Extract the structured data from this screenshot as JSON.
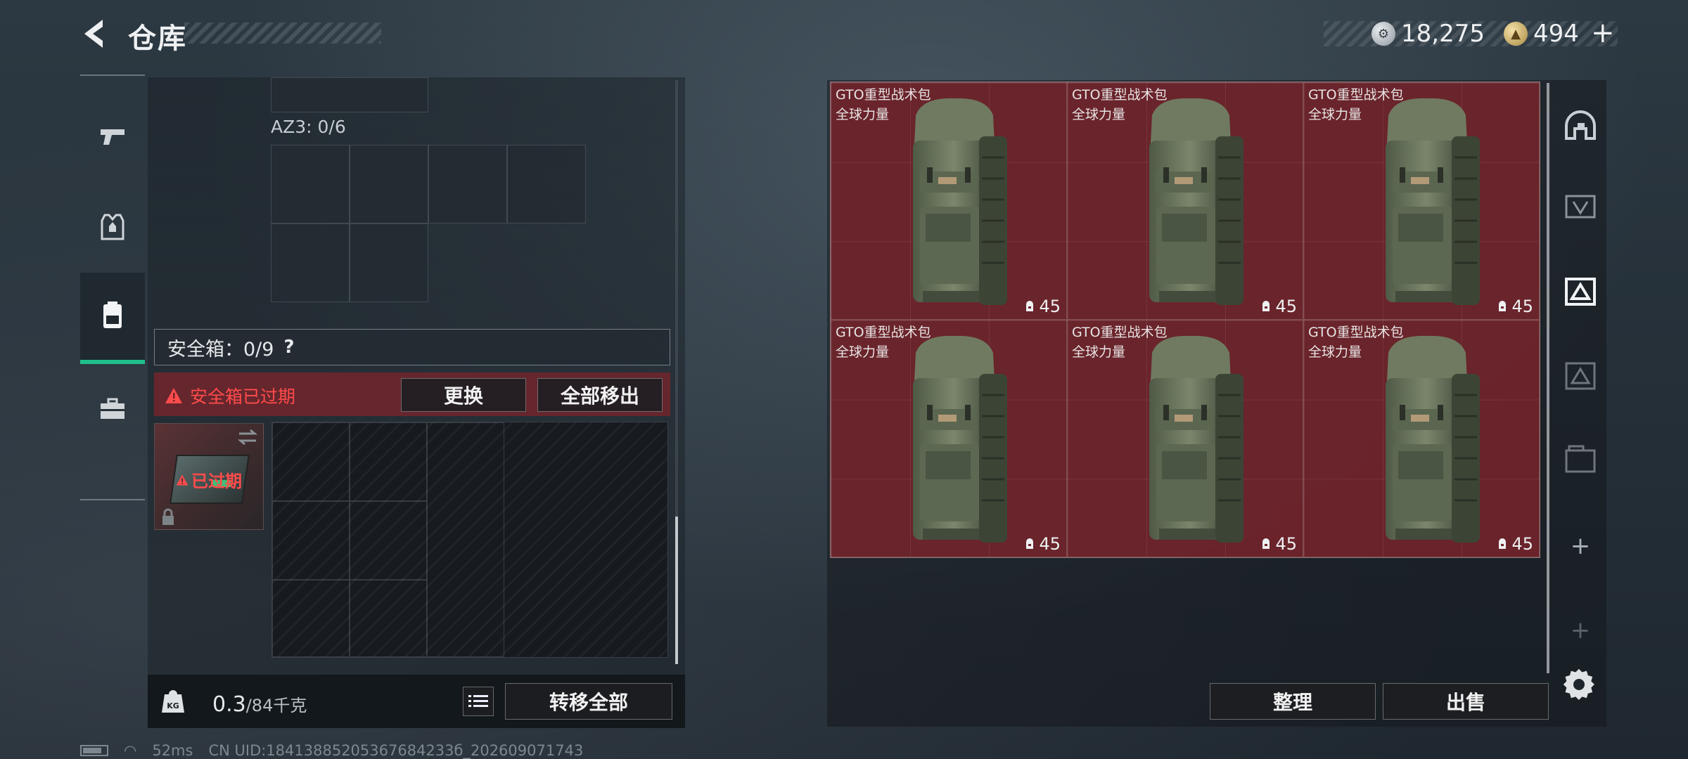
{
  "header": {
    "title": "仓库",
    "currency_silver": "18,275",
    "currency_gold": "494",
    "plus_label": "+"
  },
  "left_panel": {
    "az3_label": "AZ3: 0/6",
    "safebox_label": "安全箱：0/9",
    "help_label": "?",
    "expired_warning": "安全箱已过期",
    "replace_button": "更换",
    "move_all_button": "全部移出",
    "case_expired_label": "已过期"
  },
  "weight": {
    "current": "0.3",
    "max": "/84千克"
  },
  "transfer_all_button": "转移全部",
  "storage": {
    "items": [
      {
        "name": "GTO重型战术包",
        "sub": "全球力量",
        "count": "45"
      },
      {
        "name": "GTO重型战术包",
        "sub": "全球力量",
        "count": "45"
      },
      {
        "name": "GTO重型战术包",
        "sub": "全球力量",
        "count": "45"
      },
      {
        "name": "GTO重型战术包",
        "sub": "全球力量",
        "count": "45"
      },
      {
        "name": "GTO重型战术包",
        "sub": "全球力量",
        "count": "45"
      },
      {
        "name": "GTO重型战术包",
        "sub": "全球力量",
        "count": "45"
      }
    ],
    "sort_button": "整理",
    "sell_button": "出售"
  },
  "status_bar": {
    "ping": "52ms",
    "uid": "CN UID:18413885205367684233б_202609071743"
  },
  "colors": {
    "accent_green": "#1fbf8a",
    "warning_red": "#ff4b4b",
    "item_bg": "#6e242c"
  }
}
